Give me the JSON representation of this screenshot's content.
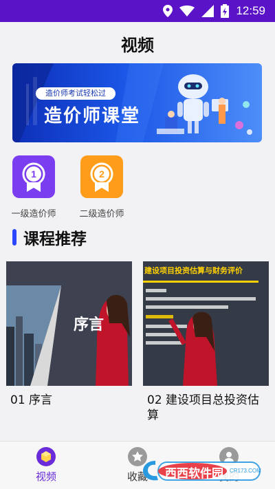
{
  "status": {
    "time": "12:59"
  },
  "header": {
    "title": "视频"
  },
  "banner": {
    "subtitle": "造价师考试轻松过",
    "title": "造价师课堂"
  },
  "categories": [
    {
      "label": "一级造价师",
      "badge": "1",
      "color": "#7b3df0"
    },
    {
      "label": "二级造价师",
      "badge": "2",
      "color": "#ff9d1a"
    }
  ],
  "section": {
    "title": "课程推荐"
  },
  "courses": [
    {
      "caption": "01 序言",
      "slide_text": "序言"
    },
    {
      "caption": "02 建设项目总投资估算",
      "slide_heading": "建设项目投资估算与财务评价"
    }
  ],
  "nav": {
    "items": [
      {
        "label": "视频",
        "active": true
      },
      {
        "label": "收藏",
        "active": false
      },
      {
        "label": "我的",
        "active": false
      }
    ]
  },
  "watermark": {
    "text": "西西软件园",
    "subtext": "CR173.COM"
  },
  "colors": {
    "statusbar": "#5b13c8",
    "accent": "#2b48ff",
    "nav_active": "#6a2bd9"
  }
}
